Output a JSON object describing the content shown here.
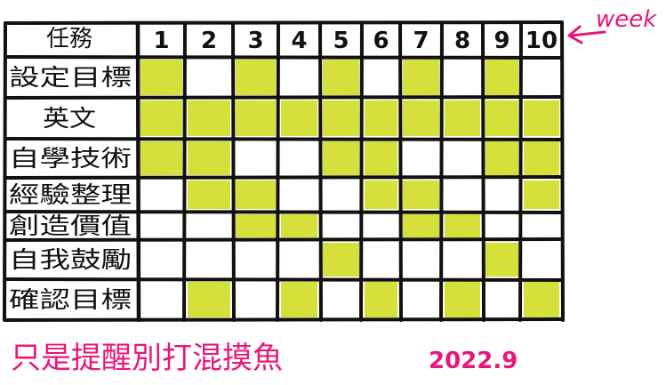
{
  "header": {
    "task_label": "任務",
    "week_annotation": "week"
  },
  "weeks": [
    "1",
    "2",
    "3",
    "4",
    "5",
    "6",
    "7",
    "8",
    "9",
    "10"
  ],
  "tasks": [
    {
      "label": "設定目標",
      "cells": [
        1,
        0,
        1,
        0,
        1,
        0,
        1,
        0,
        1,
        0
      ]
    },
    {
      "label": "英文",
      "cells": [
        1,
        1,
        1,
        1,
        1,
        1,
        1,
        1,
        1,
        1
      ]
    },
    {
      "label": "自學技術",
      "cells": [
        1,
        1,
        0,
        0,
        1,
        1,
        0,
        0,
        1,
        1
      ]
    },
    {
      "label": "經驗整理",
      "cells": [
        0,
        1,
        1,
        0,
        0,
        1,
        1,
        0,
        0,
        1
      ]
    },
    {
      "label": "創造價值",
      "cells": [
        0,
        0,
        1,
        1,
        0,
        0,
        1,
        1,
        0,
        0
      ]
    },
    {
      "label": "自我鼓勵",
      "cells": [
        0,
        0,
        0,
        0,
        1,
        0,
        0,
        0,
        1,
        0
      ]
    },
    {
      "label": "確認目標",
      "cells": [
        0,
        1,
        0,
        1,
        0,
        1,
        0,
        1,
        0,
        1
      ]
    }
  ],
  "footer": {
    "note": "只是提醒別打混摸魚",
    "date": "2022.9"
  },
  "colors": {
    "fill": "#d6e03a",
    "grid": "#111111",
    "accent": "#e8177a"
  }
}
